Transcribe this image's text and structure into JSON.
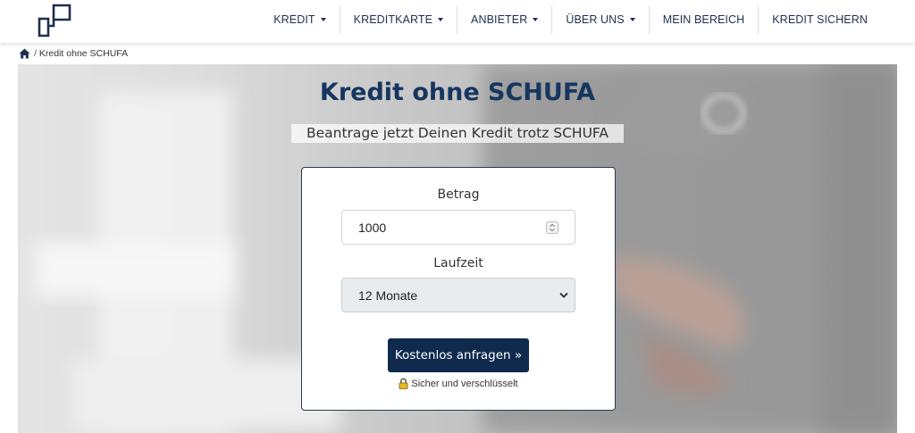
{
  "nav": {
    "items": [
      {
        "label": "KREDIT",
        "has_dropdown": true
      },
      {
        "label": "KREDITKARTE",
        "has_dropdown": true
      },
      {
        "label": "ANBIETER",
        "has_dropdown": true
      },
      {
        "label": "ÜBER UNS",
        "has_dropdown": true
      },
      {
        "label": "MEIN BEREICH",
        "has_dropdown": false
      },
      {
        "label": "KREDIT SICHERN",
        "has_dropdown": false
      }
    ]
  },
  "breadcrumb": {
    "home_icon": "home-icon",
    "separator": "/",
    "current": "Kredit ohne SCHUFA"
  },
  "hero": {
    "title": "Kredit ohne SCHUFA",
    "subtitle": "Beantrage jetzt Deinen Kredit trotz SCHUFA"
  },
  "form": {
    "amount_label": "Betrag",
    "amount_value": "1000",
    "term_label": "Laufzeit",
    "term_selected": "12 Monate",
    "submit_label": "Kostenlos anfragen »",
    "secure_text": "Sicher und verschlüsselt"
  },
  "colors": {
    "brand_navy": "#0f2a4c",
    "title_blue": "#16365f",
    "lock_yellow": "#e8b923"
  }
}
